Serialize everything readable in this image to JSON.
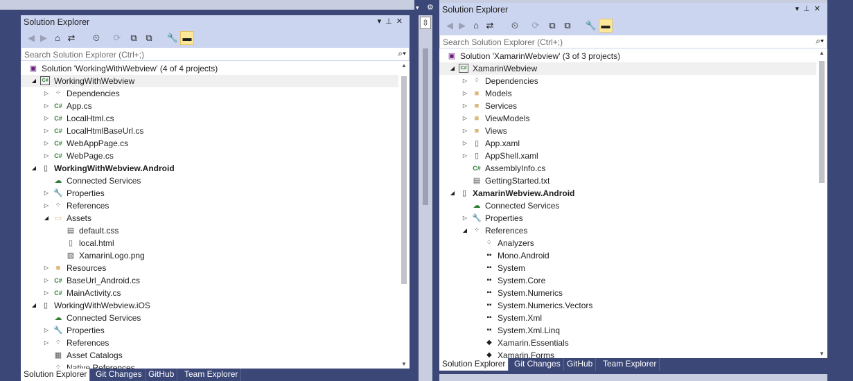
{
  "left": {
    "title": "Solution Explorer",
    "search_placeholder": "Search Solution Explorer (Ctrl+;)",
    "tree": [
      {
        "label": "Solution 'WorkingWithWebview' (4 of 4 projects)",
        "icon": "solution-icon",
        "indent": 0,
        "arrow": ""
      },
      {
        "label": "WorkingWithWebview",
        "icon": "csharp-project-icon",
        "indent": 1,
        "arrow": "expanded",
        "selected": true
      },
      {
        "label": "Dependencies",
        "icon": "dependencies-icon",
        "indent": 2,
        "arrow": "collapsed"
      },
      {
        "label": "App.cs",
        "icon": "csharp-file-icon",
        "indent": 2,
        "arrow": "collapsed"
      },
      {
        "label": "LocalHtml.cs",
        "icon": "csharp-file-icon",
        "indent": 2,
        "arrow": "collapsed"
      },
      {
        "label": "LocalHtmlBaseUrl.cs",
        "icon": "csharp-file-icon",
        "indent": 2,
        "arrow": "collapsed"
      },
      {
        "label": "WebAppPage.cs",
        "icon": "csharp-file-icon",
        "indent": 2,
        "arrow": "collapsed"
      },
      {
        "label": "WebPage.cs",
        "icon": "csharp-file-icon",
        "indent": 2,
        "arrow": "collapsed"
      },
      {
        "label": "WorkingWithWebview.Android",
        "icon": "android-project-icon",
        "indent": 1,
        "arrow": "expanded",
        "bold": true
      },
      {
        "label": "Connected Services",
        "icon": "connected-services-icon",
        "indent": 2,
        "arrow": ""
      },
      {
        "label": "Properties",
        "icon": "wrench-icon",
        "indent": 2,
        "arrow": "collapsed"
      },
      {
        "label": "References",
        "icon": "references-icon",
        "indent": 2,
        "arrow": "collapsed"
      },
      {
        "label": "Assets",
        "icon": "folder-open-icon",
        "indent": 2,
        "arrow": "expanded"
      },
      {
        "label": "default.css",
        "icon": "css-file-icon",
        "indent": 3,
        "arrow": ""
      },
      {
        "label": "local.html",
        "icon": "html-file-icon",
        "indent": 3,
        "arrow": ""
      },
      {
        "label": "XamarinLogo.png",
        "icon": "image-file-icon",
        "indent": 3,
        "arrow": ""
      },
      {
        "label": "Resources",
        "icon": "folder-icon",
        "indent": 2,
        "arrow": "collapsed"
      },
      {
        "label": "BaseUrl_Android.cs",
        "icon": "csharp-file-icon",
        "indent": 2,
        "arrow": "collapsed"
      },
      {
        "label": "MainActivity.cs",
        "icon": "csharp-file-icon",
        "indent": 2,
        "arrow": "collapsed"
      },
      {
        "label": "WorkingWithWebview.iOS",
        "icon": "ios-project-icon",
        "indent": 1,
        "arrow": "expanded"
      },
      {
        "label": "Connected Services",
        "icon": "connected-services-icon",
        "indent": 2,
        "arrow": ""
      },
      {
        "label": "Properties",
        "icon": "wrench-icon",
        "indent": 2,
        "arrow": "collapsed"
      },
      {
        "label": "References",
        "icon": "references-icon",
        "indent": 2,
        "arrow": "collapsed"
      },
      {
        "label": "Asset Catalogs",
        "icon": "asset-catalog-icon",
        "indent": 2,
        "arrow": ""
      },
      {
        "label": "Native References",
        "icon": "references-icon",
        "indent": 2,
        "arrow": ""
      }
    ],
    "tabs": [
      "Solution Explorer",
      "Git Changes",
      "GitHub",
      "Team Explorer"
    ]
  },
  "right": {
    "title": "Solution Explorer",
    "search_placeholder": "Search Solution Explorer (Ctrl+;)",
    "tree": [
      {
        "label": "Solution 'XamarinWebview' (3 of 3 projects)",
        "icon": "solution-icon",
        "indent": 0,
        "arrow": ""
      },
      {
        "label": "XamarinWebview",
        "icon": "csharp-project-icon",
        "indent": 1,
        "arrow": "expanded",
        "selected": true
      },
      {
        "label": "Dependencies",
        "icon": "dependencies-icon",
        "indent": 2,
        "arrow": "collapsed"
      },
      {
        "label": "Models",
        "icon": "folder-icon",
        "indent": 2,
        "arrow": "collapsed"
      },
      {
        "label": "Services",
        "icon": "folder-icon",
        "indent": 2,
        "arrow": "collapsed"
      },
      {
        "label": "ViewModels",
        "icon": "folder-icon",
        "indent": 2,
        "arrow": "collapsed"
      },
      {
        "label": "Views",
        "icon": "folder-icon",
        "indent": 2,
        "arrow": "collapsed"
      },
      {
        "label": "App.xaml",
        "icon": "xaml-file-icon",
        "indent": 2,
        "arrow": "collapsed"
      },
      {
        "label": "AppShell.xaml",
        "icon": "xaml-file-icon",
        "indent": 2,
        "arrow": "collapsed"
      },
      {
        "label": "AssemblyInfo.cs",
        "icon": "csharp-file-icon",
        "indent": 2,
        "arrow": ""
      },
      {
        "label": "GettingStarted.txt",
        "icon": "text-file-icon",
        "indent": 2,
        "arrow": ""
      },
      {
        "label": "XamarinWebview.Android",
        "icon": "android-project-icon",
        "indent": 1,
        "arrow": "expanded",
        "bold": true
      },
      {
        "label": "Connected Services",
        "icon": "connected-services-icon",
        "indent": 2,
        "arrow": ""
      },
      {
        "label": "Properties",
        "icon": "wrench-icon",
        "indent": 2,
        "arrow": "collapsed"
      },
      {
        "label": "References",
        "icon": "references-icon",
        "indent": 2,
        "arrow": "expanded"
      },
      {
        "label": "Analyzers",
        "icon": "analyzers-icon",
        "indent": 3,
        "arrow": ""
      },
      {
        "label": "Mono.Android",
        "icon": "assembly-icon",
        "indent": 3,
        "arrow": ""
      },
      {
        "label": "System",
        "icon": "assembly-icon",
        "indent": 3,
        "arrow": ""
      },
      {
        "label": "System.Core",
        "icon": "assembly-icon",
        "indent": 3,
        "arrow": ""
      },
      {
        "label": "System.Numerics",
        "icon": "assembly-icon",
        "indent": 3,
        "arrow": ""
      },
      {
        "label": "System.Numerics.Vectors",
        "icon": "assembly-icon",
        "indent": 3,
        "arrow": ""
      },
      {
        "label": "System.Xml",
        "icon": "assembly-icon",
        "indent": 3,
        "arrow": ""
      },
      {
        "label": "System.Xml.Linq",
        "icon": "assembly-icon",
        "indent": 3,
        "arrow": ""
      },
      {
        "label": "Xamarin.Essentials",
        "icon": "nuget-icon",
        "indent": 3,
        "arrow": ""
      },
      {
        "label": "Xamarin.Forms",
        "icon": "nuget-icon",
        "indent": 3,
        "arrow": ""
      }
    ],
    "tabs": [
      "Solution Explorer",
      "Git Changes",
      "GitHub",
      "Team Explorer"
    ]
  },
  "toolbar_icons": [
    "back-icon",
    "forward-icon",
    "home-icon",
    "switch-views-icon",
    "pending-changes-filter-icon",
    "sync-icon",
    "collapse-all-icon",
    "show-all-files-icon",
    "properties-icon",
    "preview-icon"
  ]
}
